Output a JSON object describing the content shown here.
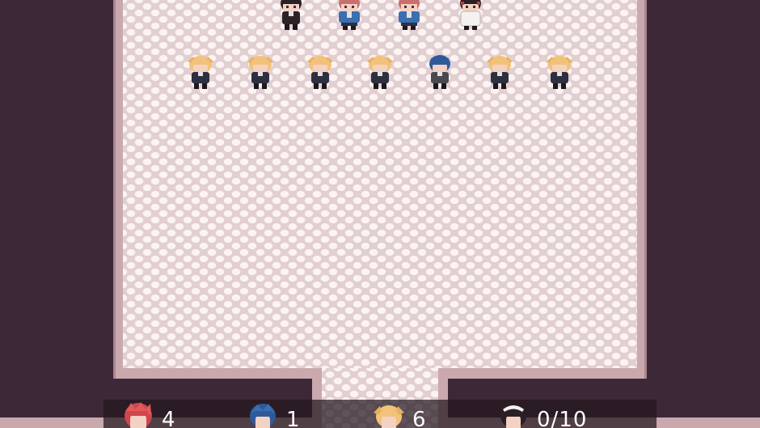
{
  "hud": {
    "red_haired_count": "4",
    "blue_haired_count": "1",
    "blonde_count": "6",
    "maid_progress": "0/10"
  },
  "colors": {
    "void": "#3d2838",
    "wall": "#c9a9ae",
    "floor": "#f1e6e6",
    "hud_background": "#23161e",
    "hud_text": "#ffffff"
  },
  "characters": {
    "top_row": [
      "dark-haired-student",
      "pink-haired-student-blue-jacket",
      "pink-haired-student-blue-jacket",
      "maid"
    ],
    "second_row": [
      "blonde-student",
      "blonde-student",
      "blonde-student",
      "blonde-student",
      "blue-haired-student",
      "blonde-student",
      "blonde-student"
    ]
  }
}
